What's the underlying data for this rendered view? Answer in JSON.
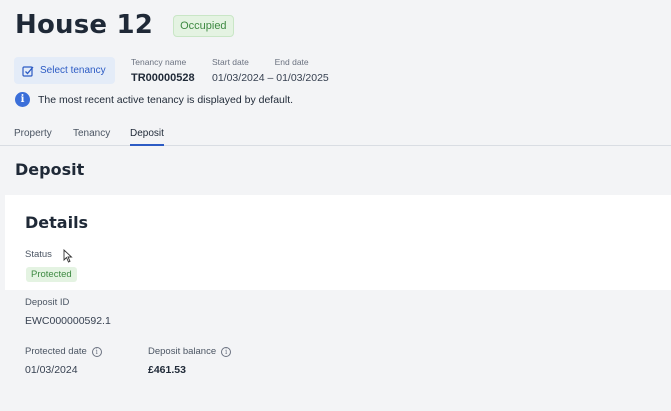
{
  "header": {
    "title": "House 12",
    "status": "Occupied"
  },
  "tenancy": {
    "select_label": "Select tenancy",
    "name_label": "Tenancy name",
    "name_value": "TR00000528",
    "start_label": "Start date",
    "end_label": "End date",
    "date_range": "01/03/2024 – 01/03/2025",
    "info_text": "The most recent active tenancy is displayed by default."
  },
  "tabs": [
    {
      "label": "Property"
    },
    {
      "label": "Tenancy"
    },
    {
      "label": "Deposit",
      "active": true
    }
  ],
  "section": {
    "title": "Deposit"
  },
  "details": {
    "title": "Details",
    "status_label": "Status",
    "status_value": "Protected",
    "deposit_id_label": "Deposit ID",
    "deposit_id_value": "EWC000000592.1",
    "protected_date_label": "Protected date",
    "protected_date_value": "01/03/2024",
    "balance_label": "Deposit balance",
    "balance_value": "£461.53"
  },
  "colors": {
    "accent": "#2c5bc4",
    "success_bg": "#e4f3e2",
    "success_text": "#3e8a42",
    "info": "#3b6fd9"
  }
}
